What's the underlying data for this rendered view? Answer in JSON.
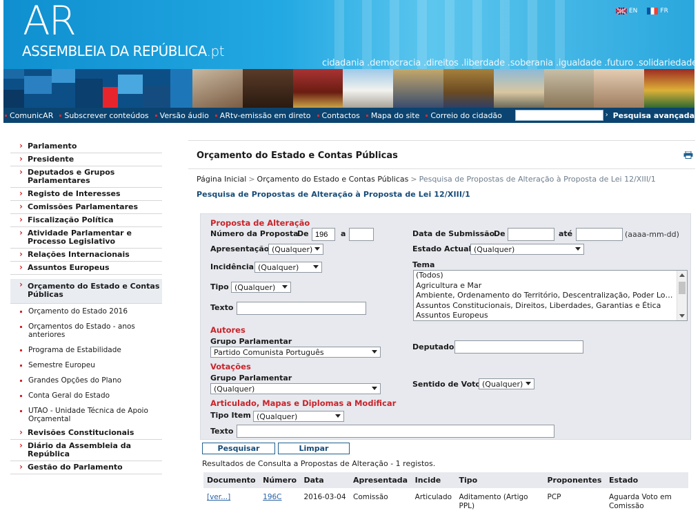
{
  "header": {
    "logo_letters": "AR",
    "logo_name": "ASSEMBLEIA DA REPÚBLICA",
    "logo_suffix": ".pt",
    "slogan": "cidadania .democracia .direitos .liberdade .soberania .igualdade .futuro .solidariedade",
    "languages": [
      {
        "code": "EN",
        "flag": "flag-uk"
      },
      {
        "code": "FR",
        "flag": "flag-fr"
      }
    ],
    "nav": [
      "ComunicAR",
      "Subscrever conteúdos",
      "Versão áudio",
      "ARtv-emissão em direto",
      "Contactos",
      "Mapa do site",
      "Correio do cidadão"
    ],
    "search_value": "",
    "search_go": "›",
    "advanced_search": "Pesquisa avançada",
    "colors": {
      "header_blue": "#169ed9",
      "nav_bg": "#0b4470",
      "accent_red": "#d4252b"
    }
  },
  "sidebar": {
    "items_top": [
      "Parlamento",
      "Presidente",
      "Deputados e Grupos Parlamentares",
      "Registo de Interesses",
      "Comissões Parlamentares",
      "Fiscalização Política",
      "Atividade Parlamentar e Processo Legislativo",
      "Relações Internacionais",
      "Assuntos Europeus"
    ],
    "active": "Orçamento do Estado e Contas Públicas",
    "subitems": [
      "Orçamento do Estado 2016",
      "Orçamentos do Estado - anos anteriores",
      "Programa de Estabilidade",
      "Semestre Europeu",
      "Grandes Opções do Plano",
      "Conta Geral do Estado",
      "UTAO - Unidade Técnica de Apoio Orçamental"
    ],
    "items_bottom": [
      "Revisões Constitucionais",
      "Diário da Assembleia da República",
      "Gestão do Parlamento"
    ]
  },
  "main": {
    "title": "Orçamento do Estado e Contas Públicas",
    "print_icon": "printer-icon",
    "breadcrumb": {
      "home": "Página Inicial",
      "section": "Orçamento do Estado e Contas Públicas",
      "current": "Pesquisa de Propostas de Alteração à Proposta de Lei 12/XIII/1",
      "separator": ">"
    },
    "subtitle": "Pesquisa de Propostas de Alteração à Proposta de Lei 12/XIII/1"
  },
  "form": {
    "sec_proposta": "Proposta de Alteração",
    "numero_label": "Número da Proposta",
    "de_label": "De",
    "numero_de": "196",
    "a_label": "a",
    "numero_a": "",
    "apresentacao_label": "Apresentação",
    "apresentacao_value": "(Qualquer)",
    "incidencia_label": "Incidência",
    "incidencia_value": "(Qualquer)",
    "tipo_label": "Tipo",
    "tipo_value": "(Qualquer)",
    "texto_label": "Texto",
    "texto_value": "",
    "data_label": "Data de Submissão",
    "data_de_label": "De",
    "data_de": "",
    "ate_label": "até",
    "data_ate": "",
    "date_hint": "(aaaa-mm-dd)",
    "estado_label": "Estado Actual",
    "estado_value": "(Qualquer)",
    "tema_label": "Tema",
    "tema_options": [
      "(Todos)",
      "Agricultura e Mar",
      "Ambiente, Ordenamento do Território, Descentralização, Poder Local e H…",
      "Assuntos Constitucionais, Direitos, Liberdades, Garantias e Ética",
      "Assuntos Europeus"
    ],
    "sec_autores": "Autores",
    "grupo_label": "Grupo Parlamentar",
    "autores_grupo_value": "Partido Comunista Português",
    "deputado_label": "Deputado",
    "deputado_value": "",
    "sec_votacoes": "Votações",
    "votacoes_grupo_label": "Grupo Parlamentar",
    "votacoes_grupo_value": "(Qualquer)",
    "sentido_label": "Sentido de Voto",
    "sentido_value": "(Qualquer)",
    "sec_articulado": "Articulado, Mapas e Diplomas a Modificar",
    "tipo_item_label": "Tipo Item",
    "tipo_item_value": "(Qualquer)",
    "texto2_label": "Texto",
    "texto2_value": "",
    "search_button": "Pesquisar",
    "clear_button": "Limpar"
  },
  "results": {
    "summary": "Resultados de Consulta a Propostas de Alteração - 1 registos.",
    "columns": [
      "Documento",
      "Número",
      "Data",
      "Apresentada",
      "Incide",
      "Tipo",
      "Proponentes",
      "Estado"
    ],
    "rows": [
      [
        "[ver...]",
        "196C",
        "2016-03-04",
        "Comissão",
        "Articulado",
        "Aditamento (Artigo PPL)",
        "PCP",
        "Aguarda Voto em Comissão"
      ]
    ]
  }
}
